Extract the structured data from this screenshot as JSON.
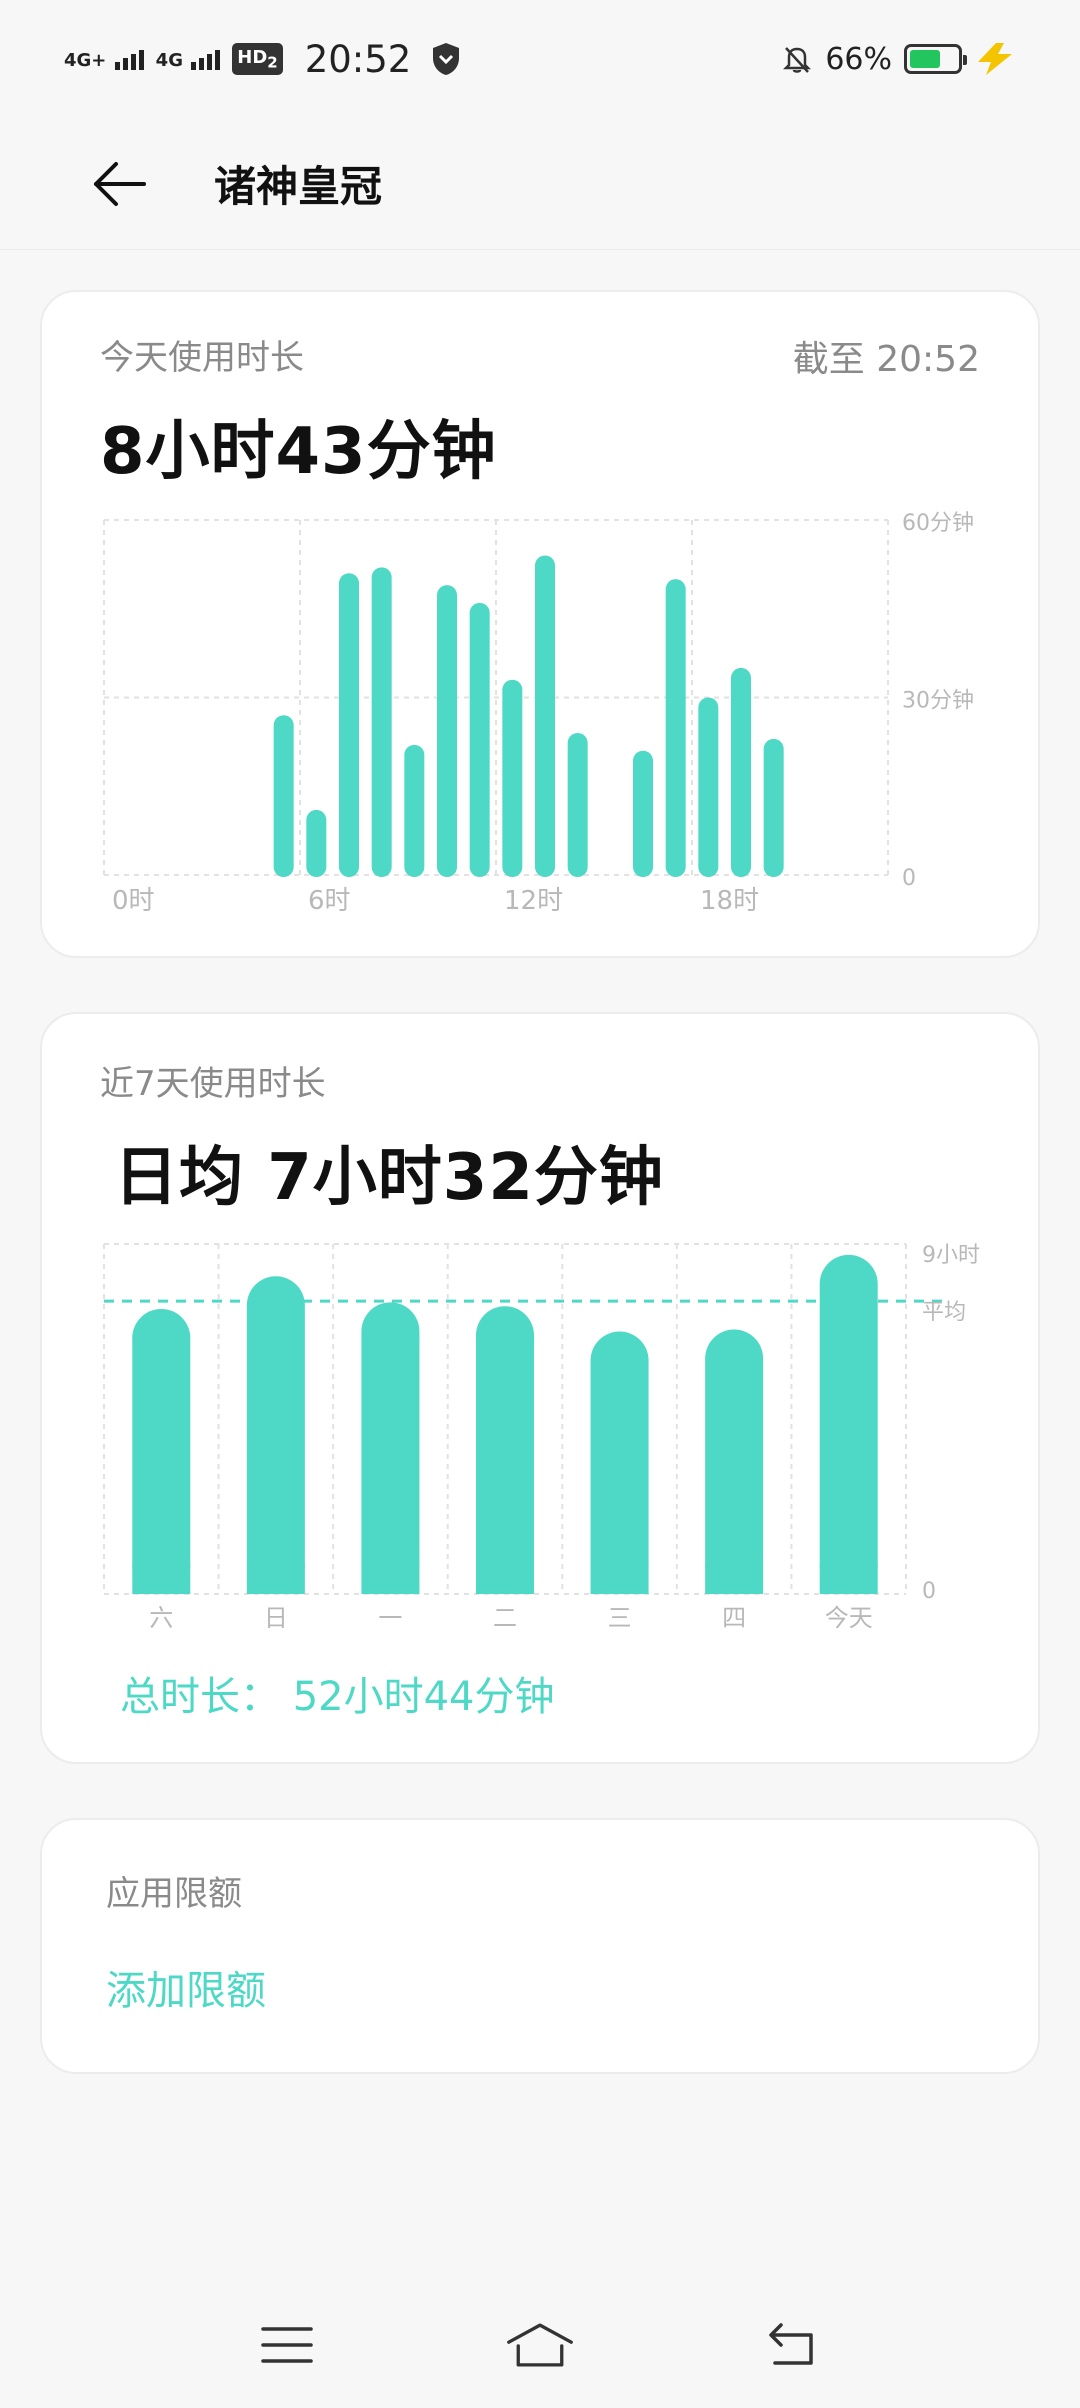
{
  "status_bar": {
    "signal1": "4G+",
    "signal2": "4G",
    "hd": "HD",
    "hd_sub": "2",
    "time": "20:52",
    "battery_percent": "66%",
    "battery_level": 0.66
  },
  "header": {
    "title": "诸神皇冠"
  },
  "today_card": {
    "label": "今天使用时长",
    "since": "截至 20:52",
    "value": "8小时43分钟",
    "chart_data": {
      "type": "bar",
      "unit": "分钟",
      "ylim": [
        0,
        60
      ],
      "y_ticks": [
        "60分钟",
        "30分钟",
        "0"
      ],
      "x_ticks": [
        "0时",
        "6时",
        "12时",
        "18时"
      ],
      "hours": [
        0,
        1,
        2,
        3,
        4,
        5,
        6,
        7,
        8,
        9,
        10,
        11,
        12,
        13,
        14,
        15,
        16,
        17,
        18,
        19,
        20,
        21,
        22,
        23
      ],
      "values": [
        0,
        0,
        0,
        0,
        0,
        27,
        11,
        51,
        52,
        22,
        49,
        46,
        33,
        54,
        24,
        0,
        21,
        50,
        30,
        35,
        23,
        0,
        0,
        0
      ],
      "color": "#4ed8c6"
    }
  },
  "week_card": {
    "label": "近7天使用时长",
    "value": "日均 7小时32分钟",
    "total": "总时长：  52小时44分钟",
    "chart_data": {
      "type": "bar",
      "unit": "小时",
      "ylim": [
        0,
        9
      ],
      "y_ticks": [
        "9小时",
        "平均",
        "0"
      ],
      "categories": [
        "六",
        "日",
        "一",
        "二",
        "三",
        "四",
        "今天"
      ],
      "values": [
        7.33,
        8.17,
        7.5,
        7.4,
        6.75,
        6.8,
        8.72
      ],
      "average": 7.53,
      "color": "#4ed8c6"
    }
  },
  "limit_card": {
    "label": "应用限额",
    "action": "添加限额"
  },
  "nav_bar": {
    "buttons": [
      "menu",
      "home",
      "back"
    ]
  }
}
